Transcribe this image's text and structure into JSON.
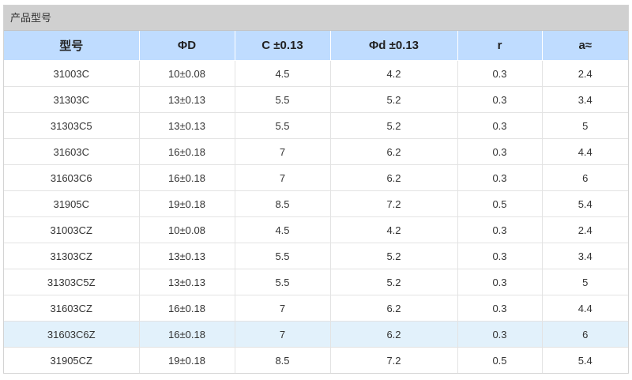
{
  "panel": {
    "title": "产品型号"
  },
  "table": {
    "headers": [
      "型号",
      "ΦD",
      "C ±0.13",
      "Φd ±0.13",
      "r",
      "a≈"
    ],
    "rows": [
      [
        "31003C",
        "10±0.08",
        "4.5",
        "4.2",
        "0.3",
        "2.4"
      ],
      [
        "31303C",
        "13±0.13",
        "5.5",
        "5.2",
        "0.3",
        "3.4"
      ],
      [
        "31303C5",
        "13±0.13",
        "5.5",
        "5.2",
        "0.3",
        "5"
      ],
      [
        "31603C",
        "16±0.18",
        "7",
        "6.2",
        "0.3",
        "4.4"
      ],
      [
        "31603C6",
        "16±0.18",
        "7",
        "6.2",
        "0.3",
        "6"
      ],
      [
        "31905C",
        "19±0.18",
        "8.5",
        "7.2",
        "0.5",
        "5.4"
      ],
      [
        "31003CZ",
        "10±0.08",
        "4.5",
        "4.2",
        "0.3",
        "2.4"
      ],
      [
        "31303CZ",
        "13±0.13",
        "5.5",
        "5.2",
        "0.3",
        "3.4"
      ],
      [
        "31303C5Z",
        "13±0.13",
        "5.5",
        "5.2",
        "0.3",
        "5"
      ],
      [
        "31603CZ",
        "16±0.18",
        "7",
        "6.2",
        "0.3",
        "4.4"
      ],
      [
        "31603C6Z",
        "16±0.18",
        "7",
        "6.2",
        "0.3",
        "6"
      ],
      [
        "31905CZ",
        "19±0.18",
        "8.5",
        "7.2",
        "0.5",
        "5.4"
      ]
    ],
    "highlighted_row": 10,
    "colors": {
      "header_bg": "#bfdcff",
      "title_bar_bg": "#d0d0d0",
      "highlight_row_bg": "#e2f1fb"
    }
  }
}
